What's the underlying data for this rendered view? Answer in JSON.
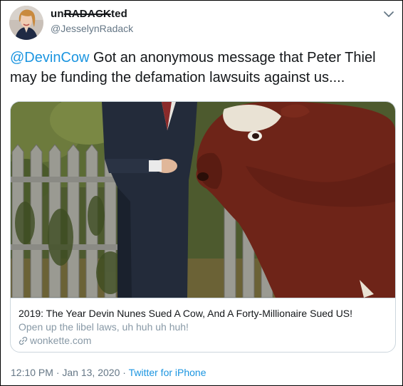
{
  "author": {
    "name_prefix": "un",
    "name_strike": "RADACK",
    "name_suffix": "ted",
    "handle": "@JesselynRadack"
  },
  "tweet": {
    "mention": "@DevinCow",
    "text": " Got an anonymous message that Peter Thiel may be funding the defamation lawsuits against us...."
  },
  "card": {
    "title": "2019: The Year Devin Nunes Sued A Cow, And A Forty-Millionaire Sued US!",
    "description": "Open up the libel laws, uh huh uh huh!",
    "domain": "wonkette.com"
  },
  "meta": {
    "time": "12:10 PM",
    "separator1": " · ",
    "date": "Jan 13, 2020",
    "separator2": " · ",
    "source": "Twitter for iPhone"
  },
  "icons": {
    "menu": "chevron-down-icon",
    "link": "link-icon"
  },
  "colors": {
    "link_blue": "#1b95e0",
    "secondary_gray": "#657786",
    "card_gray": "#8899a6",
    "border": "#ccd6dd"
  }
}
